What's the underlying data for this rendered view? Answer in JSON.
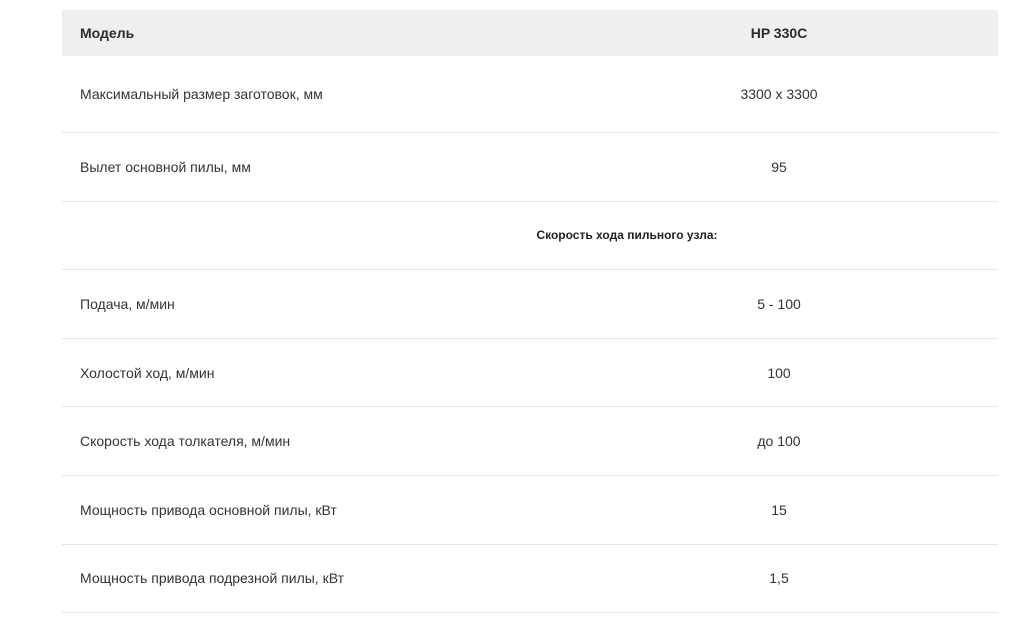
{
  "table": {
    "header": {
      "label": "Модель",
      "value": "HP 330C"
    },
    "rows": [
      {
        "label": "Максимальный размер заготовок, мм",
        "value": "3300 x 3300"
      },
      {
        "label": "Вылет основной пилы, мм",
        "value": "95"
      },
      {
        "section": "Скорость хода пильного узла:"
      },
      {
        "label": "Подача, м/мин",
        "value": "5 - 100"
      },
      {
        "label": "Холостой ход, м/мин",
        "value": "100"
      },
      {
        "label": "Скорость хода толкателя, м/мин",
        "value": "до 100"
      },
      {
        "label": "Мощность привода основной пилы, кВт",
        "value": "15"
      },
      {
        "label": "Мощность привода подрезной пилы, кВт",
        "value": "1,5"
      }
    ]
  }
}
